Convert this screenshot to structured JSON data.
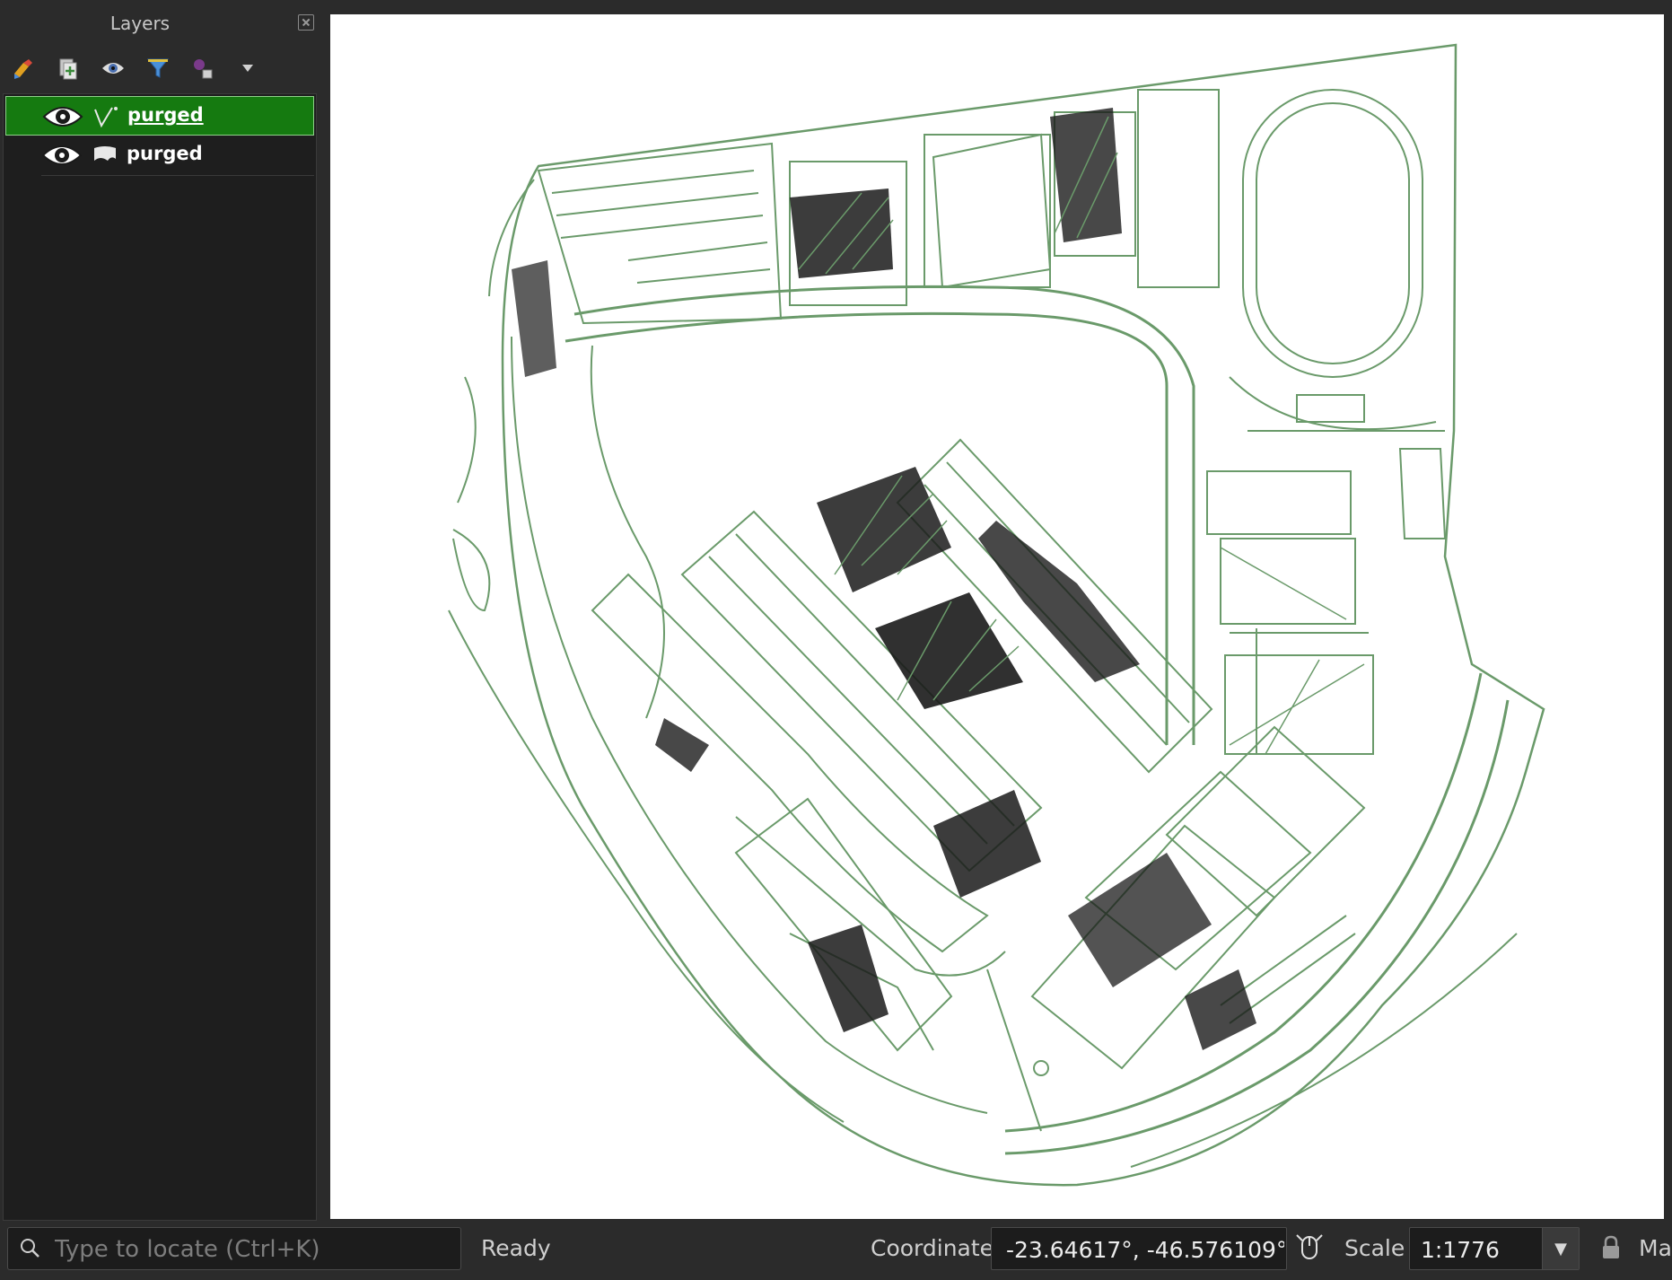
{
  "layers_panel": {
    "title": "Layers",
    "toolbar": [
      {
        "icon": "style-brush-icon"
      },
      {
        "icon": "add-group-icon"
      },
      {
        "icon": "manage-visibility-icon"
      },
      {
        "icon": "filter-legend-icon"
      },
      {
        "icon": "filter-expression-icon"
      },
      {
        "icon": "chevron-down-icon"
      }
    ],
    "layers": [
      {
        "name": "purged",
        "geometry_icon": "line-layer-icon",
        "visible": true,
        "selected": true
      },
      {
        "name": "purged",
        "geometry_icon": "polygon-layer-icon",
        "visible": true,
        "selected": false
      }
    ]
  },
  "map": {
    "stroke_color": "#6a9a6a",
    "fill_color": "#111111",
    "background": "#ffffff"
  },
  "status_bar": {
    "locator_placeholder": "Type to locate (Ctrl+K)",
    "status": "Ready",
    "coordinate_label": "Coordinate",
    "coordinate_value": "-23.64617°, -46.576109°",
    "scale_label": "Scale",
    "scale_value": "1:1776",
    "magnifier_label": "Ma"
  }
}
